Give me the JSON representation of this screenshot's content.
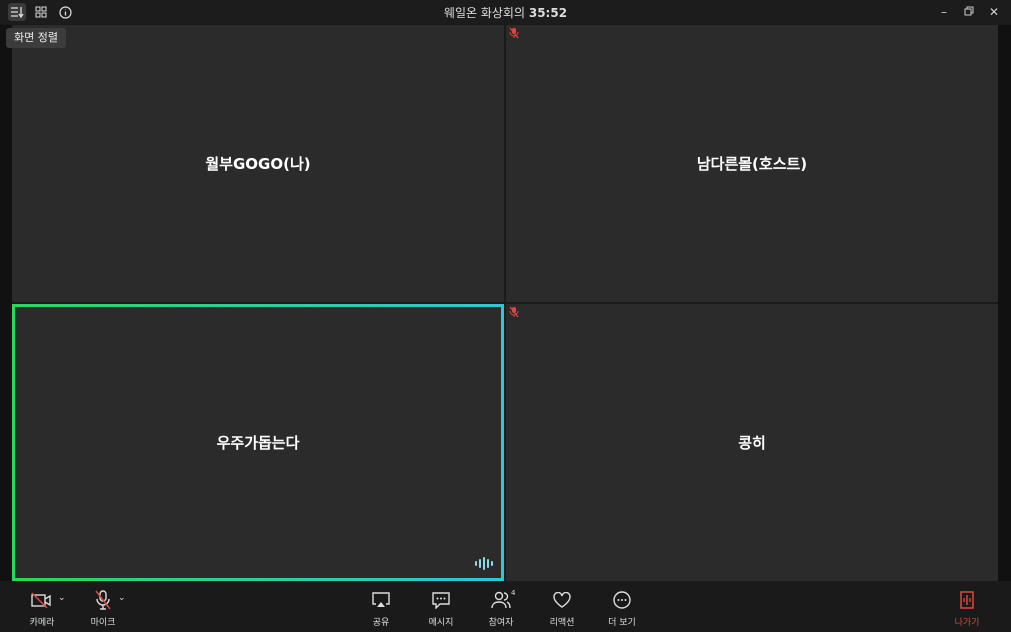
{
  "titlebar": {
    "title_prefix": "웨일온 화상회의",
    "timer": "35:52",
    "icons": [
      "sort-icon",
      "grid-icon",
      "info-icon"
    ]
  },
  "tooltip": {
    "text": "화면 정렬"
  },
  "participants": [
    {
      "name": "월부GOGO(나)",
      "muted": false,
      "speaking": false
    },
    {
      "name": "남다른몰(호스트)",
      "muted": true,
      "speaking": false
    },
    {
      "name": "우주가돕는다",
      "muted": false,
      "speaking": true
    },
    {
      "name": "콩히",
      "muted": true,
      "speaking": false
    }
  ],
  "toolbar": {
    "camera_label": "카메라",
    "mic_label": "마이크",
    "share_label": "공유",
    "message_label": "메시지",
    "participants_label": "참여자",
    "participants_count": "4",
    "reaction_label": "리액션",
    "more_label": "더 보기",
    "leave_label": "나가기"
  },
  "colors": {
    "leave": "#e0463d",
    "speaking_border_start": "#27d85a",
    "speaking_border_end": "#2ec7d8",
    "muted_icon": "#e0463d"
  }
}
